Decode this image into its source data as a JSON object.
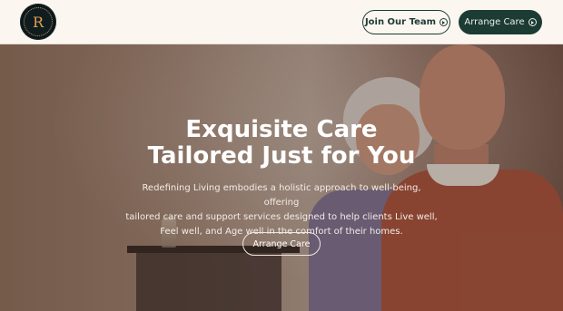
{
  "brand": {
    "logo_letter": "R"
  },
  "nav": {
    "join_label": "Join Our Team",
    "join_icon": "circle-arrow-right-icon",
    "arrange_label": "Arrange Care",
    "arrange_icon": "circle-arrow-right-icon"
  },
  "hero": {
    "title_line1": "Exquisite Care",
    "title_line2": "Tailored Just for You",
    "description_line1": "Redefining Living embodies a holistic approach to well-being, offering",
    "description_line2": "tailored care and support services designed to help clients Live well,",
    "description_line3": "Feel well, and Age well in the comfort of their homes.",
    "cta_label": "Arrange Care"
  },
  "colors": {
    "header_bg": "#fbf6ef",
    "primary_dark_green": "#1c3b33",
    "logo_accent": "#e59e4e"
  }
}
